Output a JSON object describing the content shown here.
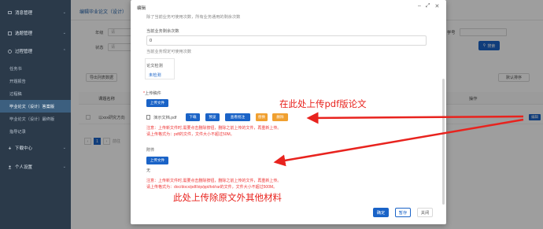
{
  "sidebar": {
    "groups": [
      {
        "label": "消息管理",
        "arrow": "⌄"
      },
      {
        "label": "选题管理",
        "arrow": "⌄"
      },
      {
        "label": "过程管理",
        "arrow": "⌃"
      }
    ],
    "items": [
      {
        "label": "任务书"
      },
      {
        "label": "开题报告"
      },
      {
        "label": "过程稿"
      },
      {
        "label": "毕业论文（设计）答案版"
      },
      {
        "label": "毕业论文（设计）最终版"
      },
      {
        "label": "指导记录"
      }
    ],
    "bottom_groups": [
      {
        "label": "下载中心",
        "arrow": "⌄"
      },
      {
        "label": "个人设置",
        "arrow": "⌄"
      }
    ]
  },
  "page": {
    "title": "编辑毕业论文（设计）",
    "filters": {
      "grade_label": "年级",
      "grade_value": "请",
      "status_label": "状态",
      "status_value": "请",
      "student_no_label": "学号"
    },
    "search_label": "搜索",
    "export_label": "导出列表数据",
    "sort_label": "默认排序",
    "table": {
      "col_title": "课题名称",
      "col_actions": "操作"
    },
    "row": {
      "title": "以xxx研究方向",
      "edit_label": "编辑"
    },
    "pager": {
      "prev": "‹",
      "current": "1",
      "next": "›",
      "goto": "前往"
    }
  },
  "modal": {
    "title": "编辑",
    "ctrl_minimize": "–",
    "ctrl_maximize": "⤢",
    "ctrl_close": "✕",
    "hint_top": "除了当前业务可使用次数，所有业务通用的剩余次数",
    "remaining_label": "当前业务剩余次数",
    "remaining_value": "0",
    "remaining_hint": "当前业务规定可使用次数",
    "check_label": "论文检测",
    "check_value": "未检测",
    "upload_label": "上传稿件",
    "upload_btn": "上传文件",
    "file_name": "演示文档.pdf",
    "file_actions": [
      "下载",
      "预览",
      "查看批注",
      "替换",
      "删除"
    ],
    "note1_line1": "注意：上传新文件时,需要点击删除按钮，删除之前上传的文件，再重新上传。",
    "note1_line2": "请上传格式为：pdf的文件，文件大小不超过50M。",
    "attachment_label": "附件",
    "attachment_btn": "上传文件",
    "attachment_empty": "无",
    "note2_line1": "注意：上传新文件时,需要点击删除按钮，删除之前上传的文件，再重新上传。",
    "note2_line2": "请上传格式为：doc/docx/pdf/zip/ppt/txt/rar的文件，文件大小不超过500M。",
    "footer": {
      "confirm": "确定",
      "save_draft": "暂存",
      "close": "关闭"
    }
  },
  "annotations": {
    "upload_pdf": "在此处上传pdf版论文",
    "upload_others": "此处上传除原文外其他材料",
    "color": "#e8231e"
  },
  "colors": {
    "primary": "#1a63c7",
    "sidebar": "#2b3a4a",
    "sidebar_active": "#3c5f7f",
    "warning": "#f0a030",
    "note_red": "#e33333"
  }
}
